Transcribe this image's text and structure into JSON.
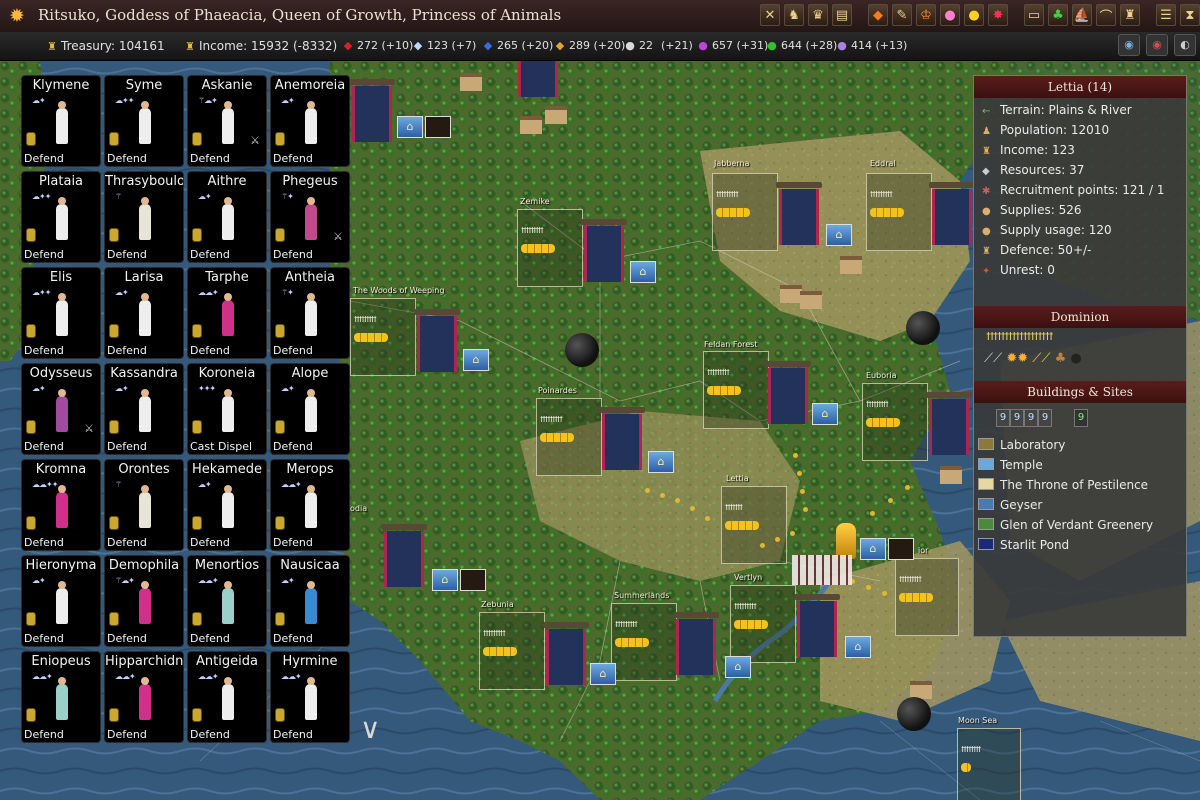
{
  "title": "Ritsuko, Goddess of Phaeacia, Queen of Growth, Princess of Animals",
  "toolbar_icons": [
    "close-x-icon",
    "army-icon",
    "crown-army-icon",
    "scroll-icon",
    "fire-icon",
    "quill-icon",
    "royal-crown-icon",
    "mushroom-icon",
    "sun-icon",
    "red-star-icon",
    "treasure-icon",
    "clover-icon",
    "ship-icon",
    "boat-icon",
    "statue-icon",
    "messages-icon",
    "hourglass-icon"
  ],
  "resources": {
    "treasury": "Treasury: 104161",
    "income": "Income: 15932 (-8332)",
    "fire": "272 (+10)",
    "air": "123 (+7)",
    "water": "265 (+20)",
    "earth": "289 (+20)",
    "astral": "22",
    "astral_delta": "(+21)",
    "death": "657 (+31)",
    "nature": "644 (+28)",
    "blood": "414 (+13)"
  },
  "commanders": [
    {
      "name": "Klymene",
      "order": "Defend",
      "robe": "#eeeeee"
    },
    {
      "name": "Syme",
      "order": "Defend",
      "robe": "#eeeeee"
    },
    {
      "name": "Askanie",
      "order": "Defend",
      "robe": "#eeeeee"
    },
    {
      "name": "Anemoreia",
      "order": "Defend",
      "robe": "#eeeeee"
    },
    {
      "name": "Plataia",
      "order": "Defend",
      "robe": "#eeeeee"
    },
    {
      "name": "Thrasyboulo",
      "order": "Defend",
      "robe": "#e8e4d8"
    },
    {
      "name": "Aithre",
      "order": "Defend",
      "robe": "#eeeeee"
    },
    {
      "name": "Phegeus",
      "order": "Defend",
      "robe": "#c04a8a"
    },
    {
      "name": "Elis",
      "order": "Defend",
      "robe": "#eeeeee"
    },
    {
      "name": "Larisa",
      "order": "Defend",
      "robe": "#eeeeee"
    },
    {
      "name": "Tarphe",
      "order": "Defend",
      "robe": "#d0308a"
    },
    {
      "name": "Antheia",
      "order": "Defend",
      "robe": "#eeeeee"
    },
    {
      "name": "Odysseus",
      "order": "Defend",
      "robe": "#a04aa0"
    },
    {
      "name": "Kassandra",
      "order": "Defend",
      "robe": "#eeeeee"
    },
    {
      "name": "Koroneia",
      "order": "Cast Dispel",
      "robe": "#eeeeee"
    },
    {
      "name": "Alope",
      "order": "Defend",
      "robe": "#eeeeee"
    },
    {
      "name": "Kromna",
      "order": "Defend",
      "robe": "#d0308a"
    },
    {
      "name": "Orontes",
      "order": "Defend",
      "robe": "#e8e4d8"
    },
    {
      "name": "Hekamede",
      "order": "Defend",
      "robe": "#eeeeee"
    },
    {
      "name": "Merops",
      "order": "Defend",
      "robe": "#eeeeee"
    },
    {
      "name": "Hieronyma",
      "order": "Defend",
      "robe": "#eeeeee"
    },
    {
      "name": "Demophila",
      "order": "Defend",
      "robe": "#d0308a"
    },
    {
      "name": "Menortios",
      "order": "Defend",
      "robe": "#9ad0c8"
    },
    {
      "name": "Nausicaa",
      "order": "Defend",
      "robe": "#3a8ad0"
    },
    {
      "name": "Eniopeus",
      "order": "Defend",
      "robe": "#9ad0c8"
    },
    {
      "name": "Hipparchidn",
      "order": "Defend",
      "robe": "#d0308a"
    },
    {
      "name": "Antigeida",
      "order": "Defend",
      "robe": "#eeeeee"
    },
    {
      "name": "Hyrmine",
      "order": "Defend",
      "robe": "#eeeeee"
    }
  ],
  "map_labels": {
    "jabberna": "Jabberna",
    "eddral": "Eddral",
    "zemike": "Zemike",
    "woods_of_weeping": "The Woods of Weeping",
    "feldan_forest": "Feldan Forest",
    "poinardes": "Poinardes",
    "leuboria": "Euboria",
    "lettia": "Lettia",
    "summerlands": "Summerlands",
    "vertlyn": "Vertlyn",
    "zebunia": "Zebunia",
    "moon_sea": "Moon Sea",
    "odia": "odia",
    "ior": "ior"
  },
  "province": {
    "header": "Lettia (14)",
    "terrain": "Terrain: Plains & River",
    "population": "Population: 12010",
    "income": "Income: 123",
    "resources": "Resources: 37",
    "recruitment": "Recruitment points: 121 / 1",
    "supplies": "Supplies: 526",
    "supply_usage": "Supply usage: 120",
    "defence": "Defence: 50+/-",
    "unrest": "Unrest: 0",
    "dominion_header": "Dominion",
    "buildings_header": "Buildings & Sites",
    "site_levels": [
      "9",
      "9",
      "9",
      "9",
      "9"
    ],
    "sites": [
      {
        "name": "Laboratory",
        "color": "#8a7a3a"
      },
      {
        "name": "Temple",
        "color": "#6aa8e0"
      },
      {
        "name": "The Throne of Pestilence",
        "color": "#e8d8a0"
      },
      {
        "name": "Geyser",
        "color": "#4a7ab0"
      },
      {
        "name": "Glen of Verdant Greenery",
        "color": "#4a8a3a"
      },
      {
        "name": "Starlit Pond",
        "color": "#1a2a7a"
      }
    ]
  }
}
